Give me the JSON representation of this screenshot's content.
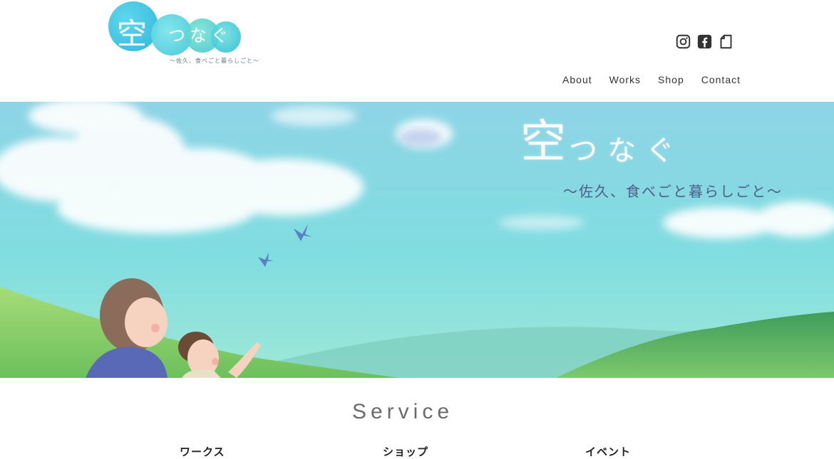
{
  "logo": {
    "main": "空",
    "rest": "つなぐ",
    "sub": "〜佐久、食べごと暮らしごと〜"
  },
  "social": [
    {
      "name": "instagram",
      "icon": "instagram-icon"
    },
    {
      "name": "facebook",
      "icon": "facebook-icon"
    },
    {
      "name": "note",
      "icon": "note-icon"
    }
  ],
  "nav": {
    "items": [
      "About",
      "Works",
      "Shop",
      "Contact"
    ]
  },
  "hero": {
    "title_main": "空",
    "title_rest": "つなぐ",
    "subtitle": "〜佐久、食べごと暮らしごと〜"
  },
  "service": {
    "title": "Service",
    "columns": [
      "ワークス",
      "ショップ",
      "イベント"
    ]
  },
  "colors": {
    "sky_top": "#8fd9e4",
    "sky_mid": "#7fdde0",
    "hill_green": "#5bb36a",
    "accent_text": "#4d5d8a"
  }
}
